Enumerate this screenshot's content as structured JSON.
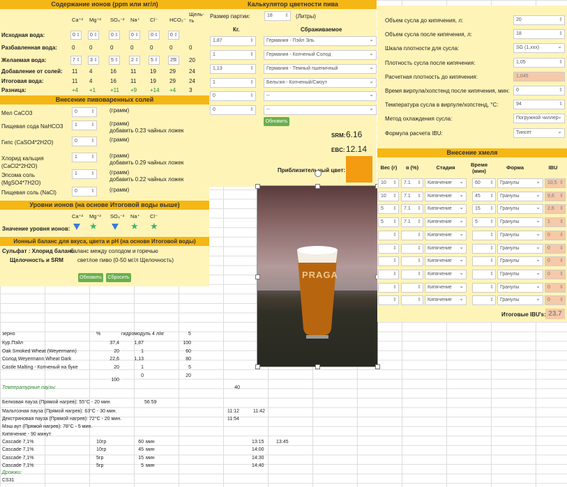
{
  "ions_panel": {
    "title": "Содержание ионов (ppm или мг/л)",
    "headers": [
      "Ca⁺²",
      "Mg⁺²",
      "SO₄⁻²",
      "Na⁺",
      "Cl⁻",
      "HCO₃⁻",
      "Щель-ть"
    ],
    "rows": [
      {
        "label": "Исходная вода:",
        "values": [
          "0",
          "0",
          "0",
          "0",
          "0",
          "0"
        ],
        "extra": ""
      },
      {
        "label": "Разбавленная вода:",
        "values": [
          "0",
          "0",
          "0",
          "0",
          "0",
          "0"
        ],
        "extra": "0"
      },
      {
        "label": "Желаемая вода:",
        "values": [
          "7",
          "3",
          "5",
          "2",
          "5",
          "25"
        ],
        "extra": "20"
      },
      {
        "label": "Добавление от солей:",
        "values": [
          "11",
          "4",
          "16",
          "11",
          "19",
          "29"
        ],
        "extra": "24"
      },
      {
        "label": "Итоговая вода:",
        "values": [
          "11",
          "4",
          "16",
          "11",
          "19",
          "29"
        ],
        "extra": "24"
      },
      {
        "label": "Разница:",
        "values": [
          "+4",
          "+1",
          "+11",
          "+9",
          "+14",
          "+4"
        ],
        "extra": "3"
      }
    ]
  },
  "salts_panel": {
    "title": "Внесение пивоваренных солей",
    "unit": "(грамм)",
    "items": [
      {
        "label": "Мел CaCO3",
        "value": "0",
        "note": ""
      },
      {
        "label": "Пищевая сода NaHCO3",
        "value": "1",
        "note": "добавить 0.23 чайных ложек"
      },
      {
        "label": "Гипс (CaSO4*2H2O)",
        "value": "0",
        "note": ""
      },
      {
        "label": "Хлорид кальция (CaCl2*2H2O)",
        "value": "1",
        "note": "добавить 0.29 чайных ложек"
      },
      {
        "label": "Эпсома соль (MgSO4*7H2O)",
        "value": "1",
        "note": "добавить 0.22 чайных ложек"
      },
      {
        "label": "Пищевая соль (NaCl)",
        "value": "0",
        "note": ""
      }
    ]
  },
  "levels_panel": {
    "title": "Уровни ионов (на основе Итоговой воды выше)",
    "label": "Значение уровня ионов:",
    "headers": [
      "Ca⁺²",
      "Mg⁺²",
      "SO₄⁻²",
      "Na⁺",
      "Cl⁻"
    ],
    "markers": [
      "triangle-icon",
      "star-icon",
      "triangle-icon",
      "star-icon",
      "star-icon"
    ]
  },
  "balance_panel": {
    "title": "Ионный баланс для вкуса, цвета и pH (на основе Итоговой воды)",
    "sulfate_label": "Сульфат : Хлорид баланс",
    "sulfate_value": "баланс между солодом и горечью",
    "alk_label": "Щелочность и SRM",
    "alk_value": "светлое пиво (0-50 мг/л Щелочность)",
    "update_btn": "Обновить",
    "reset_btn": "Сбросить"
  },
  "color_calc": {
    "title": "Калькулятор цветности пива",
    "batch_label": "Размер партии:",
    "batch_value": "18",
    "batch_unit": "(Литры)",
    "kg_header": "Кг.",
    "grain_header": "Сбраживаемое",
    "rows": [
      {
        "kg": "1,87",
        "grain": "Германия - Пэйл Эль"
      },
      {
        "kg": "1",
        "grain": "Германия - Копченый Солод"
      },
      {
        "kg": "1,13",
        "grain": "Германия - Темный пшеничный"
      },
      {
        "kg": "1",
        "grain": "Бельгия - Копченый/Смоут"
      },
      {
        "kg": "0",
        "grain": "--"
      },
      {
        "kg": "0",
        "grain": "--"
      }
    ],
    "update_btn": "Обновить",
    "srm_label": "SRM:",
    "srm_value": "6.16",
    "ebc_label": "EBC:",
    "ebc_value": "12.14",
    "color_label": "Приблизительный цвет:",
    "color_swatch": "#f39c12",
    "image_text": "PRAGA"
  },
  "wort_panel": {
    "rows": [
      {
        "label": "Объем сусла до кипячения, л:",
        "value": "20",
        "kind": "spin"
      },
      {
        "label": "Объем сусла после кипячения, л:",
        "value": "18",
        "kind": "spin"
      },
      {
        "label": "Шкала плотности для сусла:",
        "value": "SG (1,xxx)",
        "kind": "sel"
      },
      {
        "label": "Плотность сусла после кипячения:",
        "value": "1,05",
        "kind": "spin"
      },
      {
        "label": "Расчетная плотность до кипячения:",
        "value": "1,045",
        "kind": "ro"
      },
      {
        "label": "Время вирпула/хопстенд после кипячения, мин:",
        "value": "0",
        "kind": "spin"
      },
      {
        "label": "Температура сусла в вирпуле/хопстенд, °С:",
        "value": "94",
        "kind": "spin"
      },
      {
        "label": "Метод охлаждения сусла:",
        "value": "Погружной чиллер",
        "kind": "sel"
      },
      {
        "label": "Формула расчета IBU:",
        "value": "Тинсет",
        "kind": "sel"
      }
    ]
  },
  "hops_panel": {
    "title": "Внесение хмеля",
    "headers": [
      "Вес (г)",
      "α (%)",
      "Стадия",
      "Время (мин)",
      "Форма",
      "IBU"
    ],
    "rows": [
      {
        "w": "10",
        "a": "7.1",
        "stage": "Кипячение",
        "t": "60",
        "form": "Гранулы",
        "ibu": "10,5"
      },
      {
        "w": "10",
        "a": "7.1",
        "stage": "Кипячение",
        "t": "45",
        "form": "Гранулы",
        "ibu": "9,6"
      },
      {
        "w": "5",
        "a": "7.1",
        "stage": "Кипячение",
        "t": "15",
        "form": "Гранулы",
        "ibu": "2,6"
      },
      {
        "w": "5",
        "a": "7.1",
        "stage": "Кипячение",
        "t": "5",
        "form": "Гранулы",
        "ibu": "1"
      },
      {
        "w": "",
        "a": "",
        "stage": "Кипячение",
        "t": "",
        "form": "Гранулы",
        "ibu": "0"
      },
      {
        "w": "",
        "a": "",
        "stage": "Кипячение",
        "t": "",
        "form": "Гранулы",
        "ibu": "0"
      },
      {
        "w": "",
        "a": "",
        "stage": "Кипячение",
        "t": "",
        "form": "Гранулы",
        "ibu": "0"
      },
      {
        "w": "",
        "a": "",
        "stage": "Кипячение",
        "t": "",
        "form": "Гранулы",
        "ibu": "0"
      },
      {
        "w": "",
        "a": "",
        "stage": "Кипячение",
        "t": "",
        "form": "Гранулы",
        "ibu": "0"
      },
      {
        "w": "",
        "a": "",
        "stage": "Кипячение",
        "t": "",
        "form": "Гранулы",
        "ibu": "0"
      }
    ],
    "total_label": "Итоговые IBU's:",
    "total_value": "23.7"
  },
  "sheet": {
    "grain_header": {
      "c1": "зерно",
      "c2": "%",
      "c3": "гидромодуль 4 л/кг",
      "c4": "5"
    },
    "grain_rows": [
      {
        "name": "Кур.Пэйл",
        "pct": "37,4",
        "kg": "1,87",
        "v": "100"
      },
      {
        "name": "Oak Smoked Wheat (Weyermann)",
        "pct": "20",
        "kg": "1",
        "v": "60"
      },
      {
        "name": "Солод Weyermann Wheat Dark",
        "pct": "22,6",
        "kg": "1,13",
        "v": "80"
      },
      {
        "name": "Castle Malting - Копченый на буке",
        "pct": "20",
        "kg": "1",
        "v": "5"
      },
      {
        "name": "",
        "pct": "",
        "kg": "0",
        "v": "20"
      }
    ],
    "grain_total": "100",
    "temp_label": "Температурные паузы:",
    "temp_num": "40",
    "pauses": [
      {
        "text": "Белковая пауза (Прямой нагрев): 55°С - 20 мин.",
        "a": "56 59",
        "b": "",
        "c": ""
      },
      {
        "text": "Мальтозная пауза (Прямой нагрев): 63°С - 30 мин.",
        "a": "",
        "b": "11:12",
        "c": "11:42"
      },
      {
        "text": "Декстриновая пауза (Прямой нагрев): 72°С - 20 мин.",
        "a": "",
        "b": "11:54",
        "c": ""
      },
      {
        "text": "Мэш аут (Прямой нагрев): 78°С - 5 мин.",
        "a": "",
        "b": "",
        "c": ""
      },
      {
        "text": "Кипячение - 90 минут",
        "a": "",
        "b": "",
        "c": ""
      }
    ],
    "hop_rows": [
      {
        "name": "Cascade 7,1%",
        "g": "10гр",
        "m": "60",
        "u": "мин",
        "t": "13:15",
        "t2": "13:45"
      },
      {
        "name": "Cascade 7,1%",
        "g": "10гр",
        "m": "45",
        "u": "мин",
        "t": "14:00",
        "t2": ""
      },
      {
        "name": "Cascade 7,1%",
        "g": "5гр",
        "m": "15",
        "u": "мин",
        "t": "14:30",
        "t2": ""
      },
      {
        "name": "Cascade 7,1%",
        "g": "5гр",
        "m": "5",
        "u": "мин",
        "t": "14:40",
        "t2": ""
      }
    ],
    "yeast_label": "Дрожжи:",
    "yeast_value": "CS31"
  }
}
